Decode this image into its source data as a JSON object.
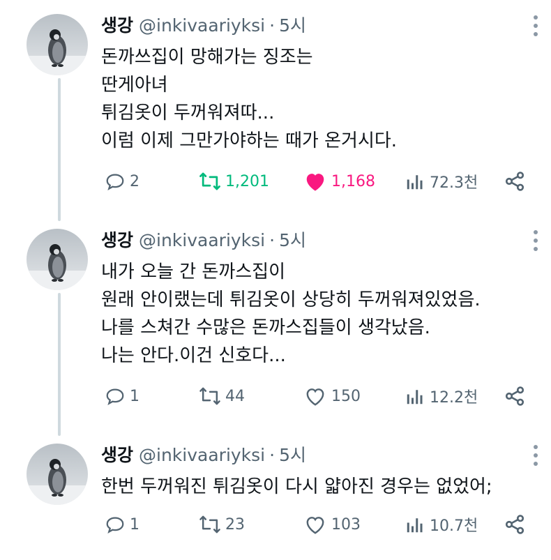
{
  "tweets": [
    {
      "name": "생강",
      "handle": "@inkivaariyksi",
      "dot": "·",
      "time": "5시",
      "lines": [
        "돈까쓰집이 망해가는 징조는",
        "딴게아녀",
        "튀김옷이 두꺼워져따...",
        "이럼 이제 그만가야하는 때가 온거시다."
      ],
      "replies": "2",
      "retweets": "1,201",
      "likes": "1,168",
      "views": "72.3천",
      "retweeted": true,
      "liked": true
    },
    {
      "name": "생강",
      "handle": "@inkivaariyksi",
      "dot": "·",
      "time": "5시",
      "lines": [
        "내가 오늘 간 돈까스집이",
        "원래 안이랬는데 튀김옷이 상당히 두꺼워져있었음.",
        "나를 스쳐간 수많은 돈까스집들이 생각났음.",
        "나는 안다.이건 신호다..."
      ],
      "replies": "1",
      "retweets": "44",
      "likes": "150",
      "views": "12.2천",
      "retweeted": false,
      "liked": false
    },
    {
      "name": "생강",
      "handle": "@inkivaariyksi",
      "dot": "·",
      "time": "5시",
      "lines": [
        "한번 두꺼워진 튀김옷이 다시 얇아진 경우는 없었어;"
      ],
      "replies": "1",
      "retweets": "23",
      "likes": "103",
      "views": "10.7천",
      "retweeted": false,
      "liked": false
    }
  ],
  "colors": {
    "text": "#0f1419",
    "secondary": "#536471",
    "retweet_active": "#00ba7c",
    "like_active": "#f91880",
    "thread_line": "#cfd9de"
  },
  "icons": [
    "reply-icon",
    "retweet-icon",
    "like-icon",
    "views-icon",
    "share-icon",
    "more-icon"
  ]
}
